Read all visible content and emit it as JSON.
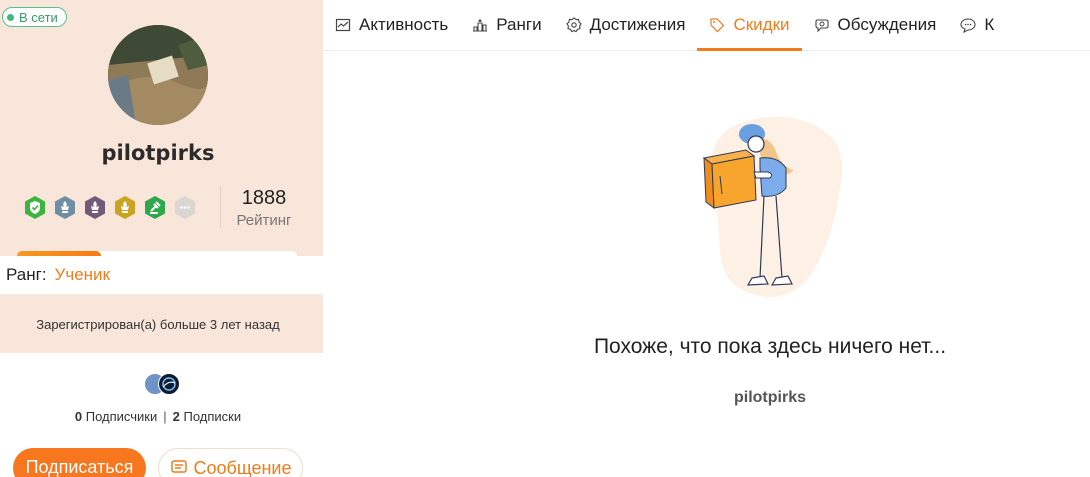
{
  "profile": {
    "status": "В сети",
    "username": "pilotpirks",
    "rating_value": "1888",
    "rating_label": "Рейтинг",
    "rank_label": "Ранг:",
    "rank_value": "Ученик",
    "rank_progress": 0.3,
    "registered": "Зарегистрирован(а) больше 3 лет назад",
    "followers_count": "0",
    "followers_label": "Подписчики",
    "following_count": "2",
    "following_label": "Подписки",
    "subscribe_label": "Подписаться",
    "message_label": "Сообщение"
  },
  "tabs": [
    {
      "label": "Активность",
      "icon": "activity-chart-icon"
    },
    {
      "label": "Ранги",
      "icon": "ranks-podium-icon"
    },
    {
      "label": "Достижения",
      "icon": "achievement-badge-icon"
    },
    {
      "label": "Скидки",
      "icon": "tag-icon"
    },
    {
      "label": "Обсуждения",
      "icon": "discussion-icon"
    },
    {
      "label": "К",
      "icon": "comment-icon"
    }
  ],
  "active_tab": "Скидки",
  "empty_state": {
    "message": "Похоже, что пока здесь ничего нет...",
    "username": "pilotpirks"
  },
  "colors": {
    "accent": "#f07c1a",
    "sidebar_bg": "#f9e6da",
    "online": "#3fb878"
  }
}
